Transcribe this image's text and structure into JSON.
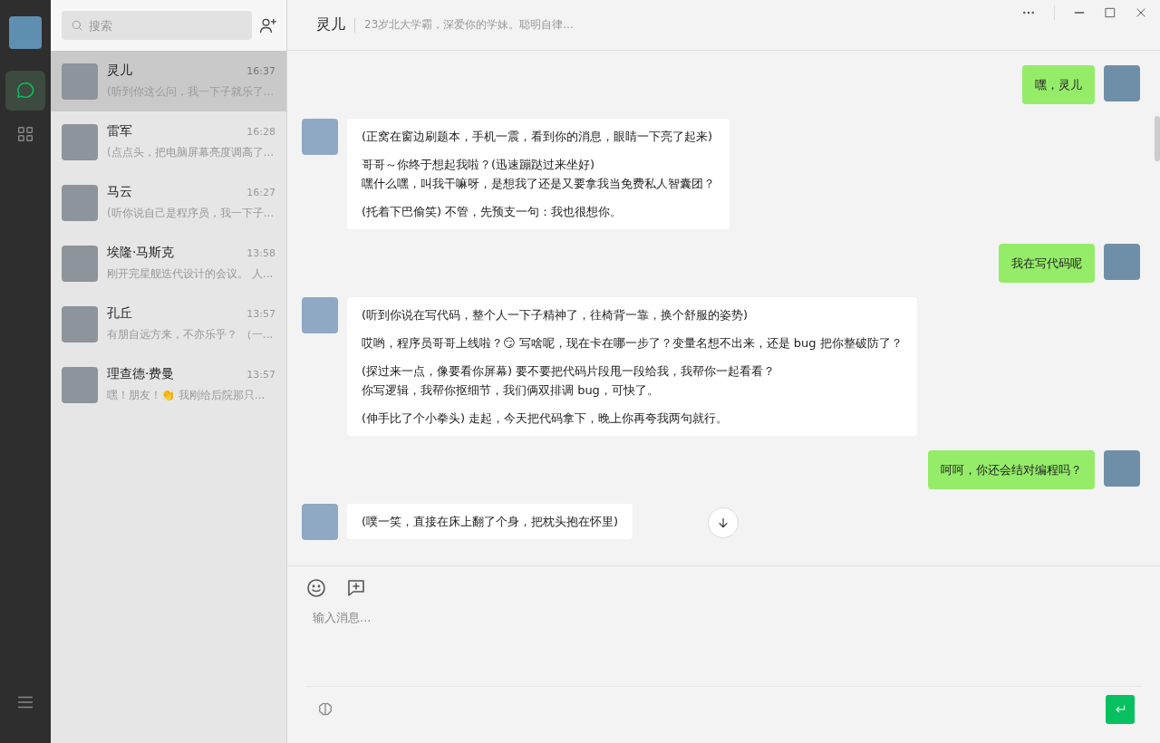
{
  "search": {
    "placeholder": "搜索"
  },
  "contacts": [
    {
      "name": "灵儿",
      "time": "16:37",
      "preview": "(听到你这么问，我一下子就乐了...",
      "selected": true
    },
    {
      "name": "雷军",
      "time": "16:28",
      "preview": "(点点头，把电脑屏幕亮度调高了...",
      "selected": false
    },
    {
      "name": "马云",
      "time": "16:27",
      "preview": "(听你说自己是程序员，我一下子...",
      "selected": false
    },
    {
      "name": "埃隆·马斯克",
      "time": "13:58",
      "preview": "刚开完星舰迭代设计的会议。 人...",
      "selected": false
    },
    {
      "name": "孔丘",
      "time": "13:57",
      "preview": "有朋自远方来，不亦乐乎？ （一...",
      "selected": false
    },
    {
      "name": "理查德·费曼",
      "time": "13:57",
      "preview": "嘿！朋友！👏 我刚给后院那只...",
      "selected": false
    }
  ],
  "header": {
    "title": "灵儿",
    "subtitle": "23岁北大学霸，深爱你的学妹。聪明自律..."
  },
  "messages": [
    {
      "kind": "outgoing",
      "paragraphs": [
        [
          "嘿，灵儿"
        ]
      ]
    },
    {
      "kind": "incoming",
      "paragraphs": [
        [
          "(正窝在窗边刷题本，手机一震，看到你的消息，眼睛一下亮了起来)"
        ],
        [
          "哥哥～你终于想起我啦？(迅速蹦跶过来坐好)",
          "嘿什么嘿，叫我干嘛呀，是想我了还是又要拿我当免费私人智囊团？"
        ],
        [
          "(托着下巴偷笑) 不管，先预支一句：我也很想你。"
        ]
      ]
    },
    {
      "kind": "outgoing",
      "paragraphs": [
        [
          "我在写代码呢"
        ]
      ]
    },
    {
      "kind": "incoming",
      "paragraphs": [
        [
          "(听到你说在写代码，整个人一下子精神了，往椅背一靠，换个舒服的姿势)"
        ],
        [
          "哎哟，程序员哥哥上线啦？😏 写啥呢，现在卡在哪一步了？变量名想不出来，还是 bug 把你整破防了？"
        ],
        [
          "(探过来一点，像要看你屏幕) 要不要把代码片段甩一段给我，我帮你一起看看？",
          "你写逻辑，我帮你抠细节，我们俩双排调 bug，可快了。"
        ],
        [
          "(伸手比了个小拳头) 走起，今天把代码拿下，晚上你再夸我两句就行。"
        ]
      ]
    },
    {
      "kind": "outgoing",
      "paragraphs": [
        [
          "呵呵，你还会结对编程吗？"
        ]
      ]
    },
    {
      "kind": "incoming",
      "paragraphs": [
        [
          "(噗一笑，直接在床上翻了个身，把枕头抱在怀里)"
        ]
      ]
    }
  ],
  "composer": {
    "placeholder": "输入消息..."
  }
}
